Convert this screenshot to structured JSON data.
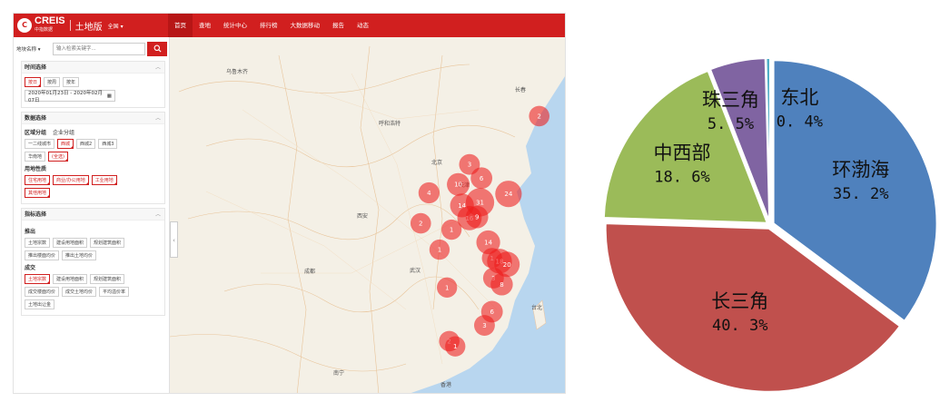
{
  "topbar": {
    "logo_text": "CREIS",
    "logo_sub": "中指数据",
    "edition": "土地版",
    "region": "全国",
    "nav": [
      "首页",
      "查地",
      "统计中心",
      "排行榜",
      "大数据移动",
      "报告",
      "动态"
    ]
  },
  "sidebar": {
    "field_select": "地块名称",
    "search_placeholder": "输入检索关键字...",
    "time": {
      "title": "时间选择",
      "periods": [
        "按日",
        "按周",
        "按年"
      ],
      "range": "2020年01月23日 - 2020年02月07日"
    },
    "data": {
      "title": "数据选择",
      "tabs": [
        "区域分组",
        "企业分组"
      ],
      "regions": [
        "一二线城市",
        "西城",
        "西城2",
        "西城3"
      ],
      "regions2": [
        "华南地",
        "(全选)"
      ],
      "usage_title": "用地性质",
      "usages": [
        "住宅用地",
        "商业/办公用地",
        "工业用地"
      ],
      "usages2": [
        "其他用地"
      ]
    },
    "indicators": {
      "title": "指标选择",
      "launch_title": "推出",
      "launch": [
        "土地宗数",
        "建设用地面积",
        "规划建筑面积"
      ],
      "launch2": [
        "推出楼面均价",
        "推出土地均价"
      ],
      "deal_title": "成交",
      "deal": [
        "土地宗数",
        "建设用地面积",
        "规划建筑面积"
      ],
      "deal2": [
        "成交楼面均价",
        "成交土地均价",
        "平均溢价率"
      ],
      "deal3": [
        "土地出让金"
      ]
    }
  },
  "map": {
    "places": [
      "乌鲁木齐",
      "呼和浩特",
      "北京",
      "西安",
      "成都",
      "武汉",
      "长春",
      "天津",
      "台北",
      "香港",
      "南宁"
    ],
    "clusters": [
      {
        "label": "2",
        "lon": 125.3,
        "lat": 44.5
      },
      {
        "label": "3",
        "lon": 116.0,
        "lat": 39.9
      },
      {
        "label": "4",
        "lon": 110.6,
        "lat": 37.2
      },
      {
        "label": "6",
        "lon": 117.6,
        "lat": 38.6
      },
      {
        "label": "10",
        "lon": 114.5,
        "lat": 38.0
      },
      {
        "label": "31",
        "lon": 117.4,
        "lat": 36.3
      },
      {
        "label": "24",
        "lon": 121.2,
        "lat": 37.1
      },
      {
        "label": "2",
        "lon": 109.5,
        "lat": 34.3
      },
      {
        "label": "14",
        "lon": 115.0,
        "lat": 36.0
      },
      {
        "label": "16",
        "lon": 116.0,
        "lat": 34.8
      },
      {
        "label": "9",
        "lon": 117.0,
        "lat": 34.9
      },
      {
        "label": "1",
        "lon": 113.6,
        "lat": 33.7
      },
      {
        "label": "14",
        "lon": 118.5,
        "lat": 32.5
      },
      {
        "label": "1",
        "lon": 112.0,
        "lat": 31.8
      },
      {
        "label": "1",
        "lon": 119.0,
        "lat": 31.0
      },
      {
        "label": "18",
        "lon": 120.0,
        "lat": 30.7
      },
      {
        "label": "20",
        "lon": 121.0,
        "lat": 30.4
      },
      {
        "label": "3",
        "lon": 119.2,
        "lat": 29.1
      },
      {
        "label": "8",
        "lon": 120.3,
        "lat": 28.5
      },
      {
        "label": "1",
        "lon": 113.0,
        "lat": 28.2
      },
      {
        "label": "6",
        "lon": 119.0,
        "lat": 25.9
      },
      {
        "label": "3",
        "lon": 118.0,
        "lat": 24.6
      },
      {
        "label": "2",
        "lon": 113.3,
        "lat": 23.1
      },
      {
        "label": "1",
        "lon": 114.1,
        "lat": 22.6
      }
    ]
  },
  "chart_data": {
    "type": "pie",
    "title": "",
    "series": [
      {
        "label": "环渤海",
        "value": 35.2,
        "value_text": "35. 2%",
        "color": "#4f81bd"
      },
      {
        "label": "长三角",
        "value": 40.3,
        "value_text": "40. 3%",
        "color": "#c0504d"
      },
      {
        "label": "中西部",
        "value": 18.6,
        "value_text": "18. 6%",
        "color": "#9bbb59"
      },
      {
        "label": "珠三角",
        "value": 5.5,
        "value_text": "5. 5%",
        "color": "#8064a2"
      },
      {
        "label": "东北",
        "value": 0.4,
        "value_text": "0. 4%",
        "color": "#4bacc6"
      }
    ],
    "start_angle_deg": 0,
    "direction": "clockwise"
  }
}
